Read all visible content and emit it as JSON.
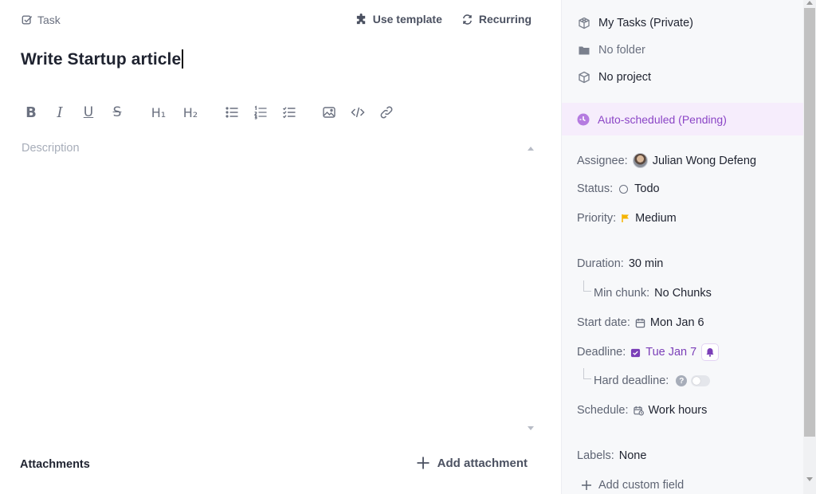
{
  "header": {
    "task_label": "Task",
    "use_template": "Use template",
    "recurring": "Recurring"
  },
  "task": {
    "title": "Write Startup article",
    "description_placeholder": "Description"
  },
  "editor_toolbar": {
    "bold": "B",
    "italic": "I",
    "underline": "U",
    "strikethrough": "S",
    "heading1": "H₁",
    "heading2": "H₂",
    "items": [
      "bold",
      "italic",
      "underline",
      "strikethrough",
      "heading1",
      "heading2",
      "bullet-list",
      "numbered-list",
      "checklist",
      "image",
      "code",
      "link"
    ]
  },
  "attachments": {
    "title": "Attachments",
    "add_label": "Add attachment"
  },
  "sidebar": {
    "workspace": "My Tasks (Private)",
    "folder": "No folder",
    "project": "No project",
    "auto_scheduled": "Auto-scheduled (Pending)",
    "assignee_label": "Assignee:",
    "assignee_value": "Julian Wong Defeng",
    "status_label": "Status:",
    "status_value": "Todo",
    "priority_label": "Priority:",
    "priority_value": "Medium",
    "duration_label": "Duration:",
    "duration_value": "30 min",
    "min_chunk_label": "Min chunk:",
    "min_chunk_value": "No Chunks",
    "start_date_label": "Start date:",
    "start_date_value": "Mon Jan 6",
    "deadline_label": "Deadline:",
    "deadline_value": "Tue Jan 7",
    "hard_deadline_label": "Hard deadline:",
    "hard_deadline_help": "?",
    "hard_deadline_enabled": false,
    "schedule_label": "Schedule:",
    "schedule_value": "Work hours",
    "labels_label": "Labels:",
    "labels_value": "None",
    "add_custom_field": "Add custom field"
  },
  "colors": {
    "accent_purple": "#8b45c6",
    "deadline_purple": "#7b3fb8",
    "autosched_bg": "#f6edfc",
    "priority_flag": "#f5b400",
    "sidebar_bg": "#f7f8fa"
  }
}
